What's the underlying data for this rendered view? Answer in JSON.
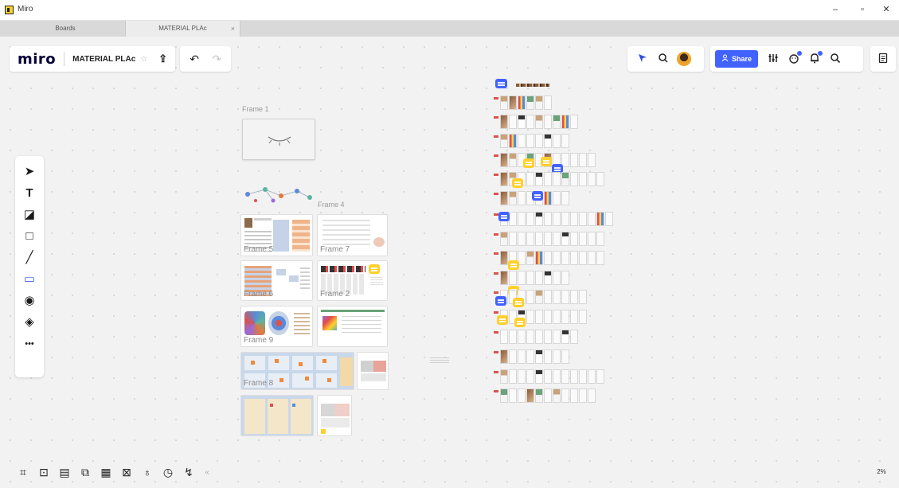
{
  "window": {
    "title": "Miro",
    "minimize": "–",
    "maximize": "▫",
    "close": "✕"
  },
  "tabs": [
    {
      "label": "Boards"
    },
    {
      "label": "MATERIAL PLAc",
      "close": "×"
    }
  ],
  "header": {
    "brand": "miro",
    "board_name": "MATERIAL PLAc",
    "star": "☆",
    "upload": "⇪",
    "undo": "↶",
    "redo": "↷"
  },
  "collab": {
    "share_label": "Share",
    "icons": [
      "cursor-icon",
      "search-user-icon",
      "avatar",
      "share-button",
      "settings-sliders-icon",
      "reactions-icon",
      "notifications-icon",
      "search-icon",
      "notes-icon"
    ]
  },
  "left_tools": [
    {
      "name": "select",
      "glyph": "➤"
    },
    {
      "name": "text",
      "glyph": "T"
    },
    {
      "name": "sticky-note",
      "glyph": "◪"
    },
    {
      "name": "shape",
      "glyph": "□"
    },
    {
      "name": "pen",
      "glyph": "╱"
    },
    {
      "name": "comment",
      "glyph": "▭"
    },
    {
      "name": "camera",
      "glyph": "◉"
    },
    {
      "name": "eraser",
      "glyph": "◈"
    },
    {
      "name": "more",
      "glyph": "•••"
    }
  ],
  "bottom_tools": [
    "⌗",
    "⊡",
    "▤",
    "⧉",
    "▦",
    "⊠",
    "♁",
    "◷",
    "↯"
  ],
  "bottom_collapse": "«",
  "zoom": "2%",
  "frames": [
    {
      "id": "frame1",
      "label": "Frame 1"
    },
    {
      "id": "frame4",
      "label": "Frame 4"
    },
    {
      "id": "frame5",
      "label": "Frame 5"
    },
    {
      "id": "frame7",
      "label": "Frame 7"
    },
    {
      "id": "frame6",
      "label": "Frame 6"
    },
    {
      "id": "frame2",
      "label": "Frame 2"
    },
    {
      "id": "frame9",
      "label": "Frame 9"
    },
    {
      "id": "frame8",
      "label": "Frame 8"
    }
  ],
  "colors": {
    "accent": "#4262ff",
    "sticky_yellow": "#ffd02f",
    "canvas": "#f2f2f2",
    "brand_text": "#050038"
  }
}
